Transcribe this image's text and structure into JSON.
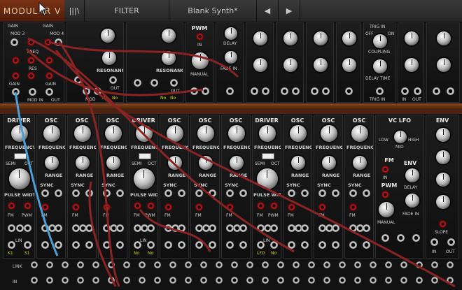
{
  "app": {
    "logo": "MODULAR V"
  },
  "topbar": {
    "bars_icon": "|||\\",
    "filter_label": "FILTER",
    "preset_name": "Blank Synth*",
    "prev_icon": "◀",
    "next_icon": "▶"
  },
  "top_modules": {
    "mixer": {
      "gain_a": "GAIN",
      "gain_b": "GAIN",
      "mod3": "MOD 3",
      "mod4": "MOD 4",
      "freq": "FREQ",
      "res": "RES",
      "gain_c": "GAIN",
      "gain_d": "GAIN",
      "mod_in": "MOD IN",
      "out": "OUT"
    },
    "filter1": {
      "resonance": "RESONANCE",
      "out": "OUT",
      "mode": "MOD",
      "led_a": "No",
      "led_b": "No"
    },
    "filter2": {
      "resonance": "RESONANCE",
      "out": "OUT",
      "led_a": "No",
      "led_b": "No"
    },
    "pwm": {
      "title": "PWM",
      "in": "IN",
      "manual": "MANUAL"
    },
    "delay": {
      "delay": "DELAY",
      "fade_in": "FADE IN"
    },
    "lfo_trig": {
      "trig_in": "TRIG IN",
      "coupling": "COUPLING",
      "delay_time": "DELAY TIME",
      "off": "OFF",
      "on": "ON"
    },
    "io": {
      "in": "IN",
      "out": "OUT"
    }
  },
  "bottom_modules": [
    {
      "title": "DRIVER",
      "freq": "FREQUENCY",
      "semi": "SEMI",
      "oct": "OCT",
      "pw": "PULSE WIDTH",
      "fm": "FM",
      "pwm": "PWM",
      "lin": "LIN",
      "led_a": "K1",
      "led_b": "S1"
    },
    {
      "title": "OSC",
      "freq": "FREQUENCY",
      "range": "RANGE",
      "sync": "SYNC",
      "fm": "FM",
      "led_a": "",
      "led_b": ""
    },
    {
      "title": "OSC",
      "freq": "FREQUENCY",
      "range": "RANGE",
      "sync": "SYNC",
      "fm": "FM"
    },
    {
      "title": "OSC",
      "freq": "FREQUENCY",
      "range": "RANGE",
      "sync": "SYNC",
      "fm": "FM"
    },
    {
      "title": "DRIVER",
      "freq": "FREQUENCY",
      "semi": "SEMI",
      "oct": "OCT",
      "pw": "PULSE WIDTH",
      "fm": "FM",
      "pwm": "PWM",
      "lin": "LIN",
      "led_a": "No",
      "led_b": "No"
    },
    {
      "title": "OSC",
      "freq": "FREQUENCY",
      "range": "RANGE",
      "sync": "SYNC",
      "fm": "FM"
    },
    {
      "title": "OSC",
      "freq": "FREQUENCY",
      "range": "RANGE",
      "sync": "SYNC",
      "fm": "FM"
    },
    {
      "title": "OSC",
      "freq": "FREQUENCY",
      "range": "RANGE",
      "sync": "SYNC",
      "fm": "FM"
    },
    {
      "title": "DRIVER",
      "freq": "FREQUENCY",
      "semi": "SEMI",
      "oct": "OCT",
      "pw": "PULSE WIDTH",
      "fm": "FM",
      "pwm": "PWM",
      "lin": "LIN",
      "led_a": "LFO",
      "led_b": "No"
    },
    {
      "title": "OSC",
      "freq": "FREQUENCY",
      "range": "RANGE",
      "sync": "SYNC",
      "fm": "FM"
    },
    {
      "title": "OSC",
      "freq": "FREQUENCY",
      "range": "RANGE",
      "sync": "SYNC",
      "fm": "FM"
    },
    {
      "title": "OSC",
      "freq": "FREQUENCY",
      "range": "RANGE",
      "sync": "SYNC",
      "fm": "FM"
    }
  ],
  "vc_lfo": {
    "title": "VC LFO",
    "low": "LOW",
    "mid": "MID",
    "high": "HIGH",
    "fm": "FM",
    "in": "IN",
    "pwm": "PWM",
    "manual": "MANUAL",
    "env": "ENV",
    "delay": "DELAY",
    "fade_in": "FADE IN"
  },
  "env": {
    "title": "ENV",
    "slope": "SLOPE",
    "in": "IN",
    "out": "OUT"
  },
  "bottom_row": {
    "link": "LINK",
    "in": "IN"
  },
  "colors": {
    "cable_red": "#8a2424",
    "cable_blue": "#4aa0d8",
    "rail": "#8a4a22"
  }
}
